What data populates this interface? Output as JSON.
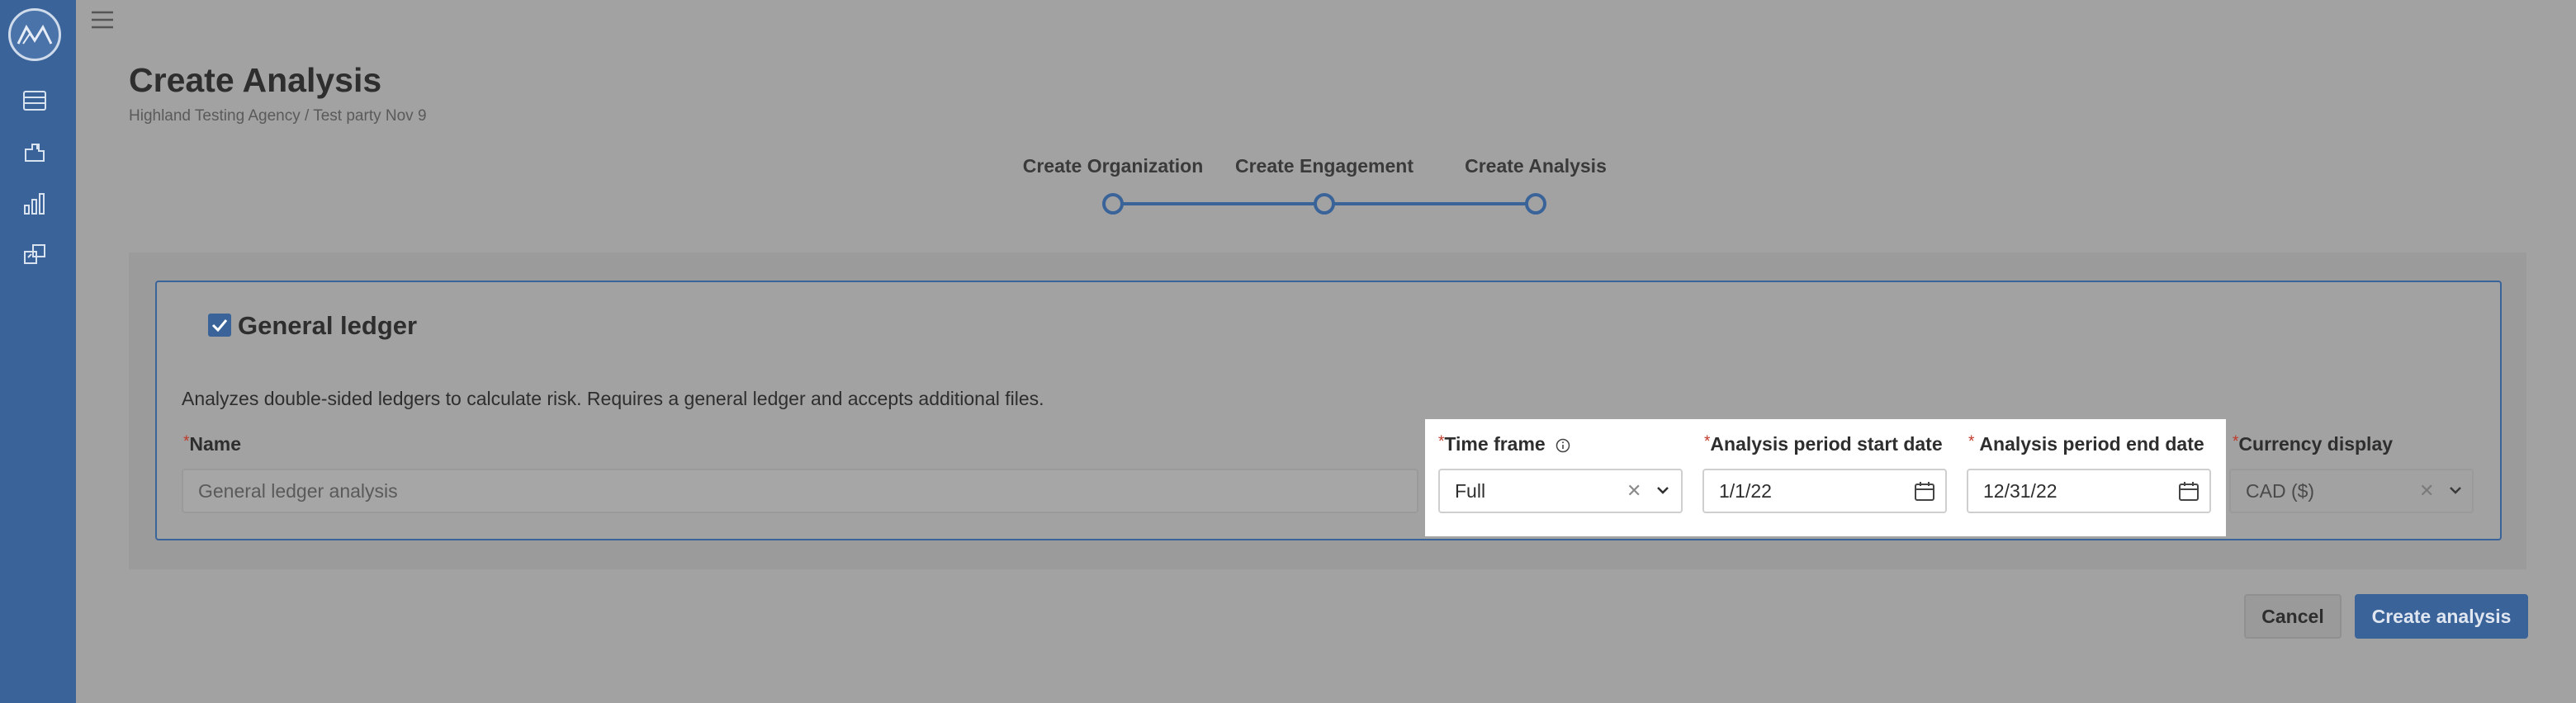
{
  "page": {
    "title": "Create Analysis",
    "breadcrumb": "Highland Testing Agency / Test party Nov 9"
  },
  "stepper": {
    "steps": [
      {
        "label": "Create Organization"
      },
      {
        "label": "Create Engagement"
      },
      {
        "label": "Create Analysis"
      }
    ]
  },
  "card": {
    "title": "General ledger",
    "checked": true,
    "description": "Analyzes double-sided ledgers to calculate risk. Requires a general ledger and accepts additional files."
  },
  "fields": {
    "name": {
      "label": "Name",
      "required": "*",
      "placeholder": "General ledger analysis"
    },
    "time_frame": {
      "label": "Time frame",
      "required": "*",
      "value": "Full"
    },
    "start_date": {
      "label": "Analysis period start date",
      "required": "*",
      "value": "1/1/22"
    },
    "end_date": {
      "label": "Analysis period end date",
      "required": "*",
      "value": "12/31/22"
    },
    "currency": {
      "label": "Currency display",
      "required": "*",
      "value": "CAD ($)"
    }
  },
  "actions": {
    "cancel_label": "Cancel",
    "create_label": "Create analysis"
  },
  "colors": {
    "accent": "#3a639a",
    "required": "#c0392b"
  }
}
